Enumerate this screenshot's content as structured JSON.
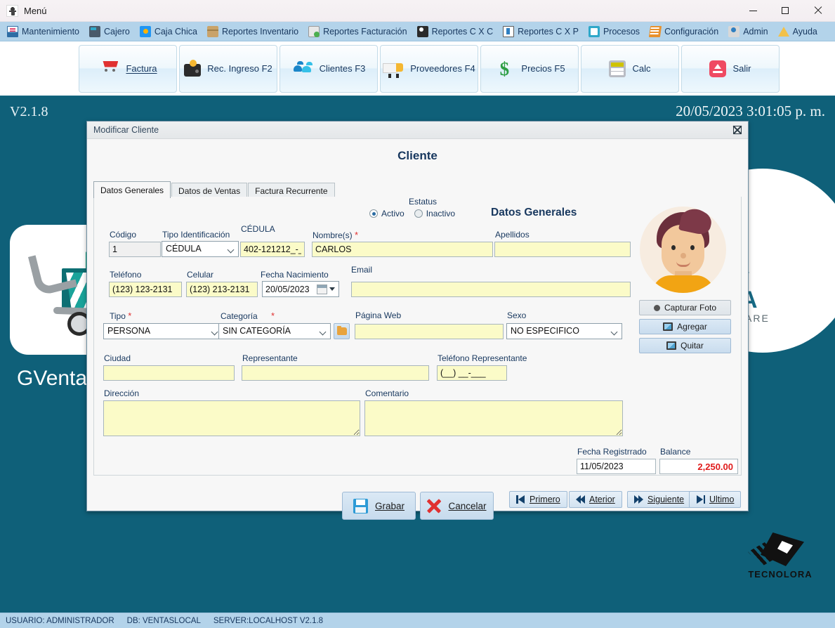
{
  "window": {
    "title": "Menú",
    "app_icon": "app-icon",
    "minimize": "minimize",
    "maximize": "maximize",
    "close": "close"
  },
  "menubar": {
    "items": [
      {
        "label": "Mantenimiento",
        "icon": "maintenance-icon"
      },
      {
        "label": "Cajero",
        "icon": "cash-register-icon"
      },
      {
        "label": "Caja Chica",
        "icon": "petty-cash-icon"
      },
      {
        "label": "Reportes Inventario",
        "icon": "inventory-reports-icon"
      },
      {
        "label": "Reportes Facturación",
        "icon": "billing-reports-icon"
      },
      {
        "label": "Reportes C X C",
        "icon": "receivable-reports-icon"
      },
      {
        "label": "Reportes C X P",
        "icon": "payable-reports-icon"
      },
      {
        "label": "Procesos",
        "icon": "processes-icon"
      },
      {
        "label": "Configuración",
        "icon": "settings-icon"
      },
      {
        "label": "Admin",
        "icon": "admin-icon"
      },
      {
        "label": "Ayuda",
        "icon": "help-icon"
      }
    ]
  },
  "toolbar": {
    "buttons": [
      {
        "label": "Factura",
        "accel": "F",
        "icon": "shopping-cart-icon"
      },
      {
        "label": "Rec. Ingreso F2",
        "icon": "wallet-icon"
      },
      {
        "label": "Clientes F3",
        "icon": "people-icon"
      },
      {
        "label": "Proveedores  F4",
        "icon": "truck-icon"
      },
      {
        "label": "Precios  F5",
        "icon": "dollar-icon"
      },
      {
        "label": "Calc",
        "icon": "calculator-icon"
      },
      {
        "label": "Salir",
        "icon": "exit-icon"
      }
    ]
  },
  "desktop": {
    "version": "V2.1.8",
    "datetime": "20/05/2023 3:01:05 p. m.",
    "brand_name": "GVentas",
    "logo_text": "ORA",
    "logo_sub": "SOFTWARE",
    "logo_domain": "a.com",
    "footer_logo": "TECNOLORA"
  },
  "dialog": {
    "title": "Modificar Cliente",
    "heading": "Cliente",
    "close_label": "✕",
    "tabs": [
      {
        "label": "Datos Generales",
        "active": true
      },
      {
        "label": "Datos de Ventas",
        "active": false
      },
      {
        "label": "Factura Recurrente",
        "active": false
      }
    ],
    "section_heading": "Datos Generales",
    "estatus": {
      "label": "Estatus",
      "options": [
        {
          "label": "Activo",
          "selected": true
        },
        {
          "label": "Inactivo",
          "selected": false
        }
      ]
    },
    "fields": {
      "codigo": {
        "label": "Código",
        "value": "1"
      },
      "tipo_identificacion": {
        "label": "Tipo Identificación",
        "value": "CÉDULA"
      },
      "cedula": {
        "label": "CÉDULA",
        "value": "402-121212_-_"
      },
      "nombres": {
        "label": "Nombre(s)",
        "required": "*",
        "value": "CARLOS"
      },
      "apellidos": {
        "label": "Apellidos",
        "value": ""
      },
      "telefono": {
        "label": "Teléfono",
        "value": "(123) 123-2131"
      },
      "celular": {
        "label": "Celular",
        "value": "(123) 213-2131"
      },
      "fecha_nacimiento": {
        "label": "Fecha Nacimiento",
        "value": "20/05/2023"
      },
      "email": {
        "label": "Email",
        "value": ""
      },
      "tipo": {
        "label": "Tipo",
        "required": "*",
        "value": "PERSONA"
      },
      "categoria": {
        "label": "Categoría",
        "required": "*",
        "value": "SIN CATEGORÍA"
      },
      "pagina_web": {
        "label": "Página Web",
        "value": ""
      },
      "sexo": {
        "label": "Sexo",
        "value": "NO ESPECIFICO"
      },
      "ciudad": {
        "label": "Ciudad",
        "value": ""
      },
      "representante": {
        "label": "Representante",
        "value": ""
      },
      "telefono_representante": {
        "label": "Teléfono Representante",
        "value": "(__) __-___"
      },
      "direccion": {
        "label": "Dirección",
        "value": ""
      },
      "comentario": {
        "label": "Comentario",
        "value": ""
      },
      "fecha_registrado": {
        "label": "Fecha Registrrado",
        "value": "11/05/2023"
      },
      "balance": {
        "label": "Balance",
        "value": "2,250.00"
      }
    },
    "photo_buttons": [
      {
        "label": "Capturar Foto",
        "icon": "camera-dot-icon"
      },
      {
        "label": "Agregar",
        "icon": "image-icon"
      },
      {
        "label": "Quitar",
        "icon": "image-icon"
      }
    ],
    "actions": {
      "save": "Grabar",
      "cancel": "Cancelar"
    },
    "navigation": [
      {
        "label": "Primero",
        "icon": "nav-first-icon"
      },
      {
        "label": "Aterior",
        "icon": "nav-prev-icon"
      },
      {
        "label": "Siguiente",
        "icon": "nav-next-icon"
      },
      {
        "label": "Ultimo",
        "icon": "nav-last-icon"
      }
    ]
  },
  "statusbar": {
    "user": "USUARIO: ADMINISTRADOR",
    "db": "DB: VENTASLOCAL",
    "server": "SERVER:LOCALHOST  V2.1.8"
  },
  "colors": {
    "desktop_bg": "#0f6079",
    "menubar_bg": "#b3d3ea",
    "field_yellow": "#fbfbc8",
    "label_blue": "#17375e",
    "balance_red": "#e01b1b"
  }
}
